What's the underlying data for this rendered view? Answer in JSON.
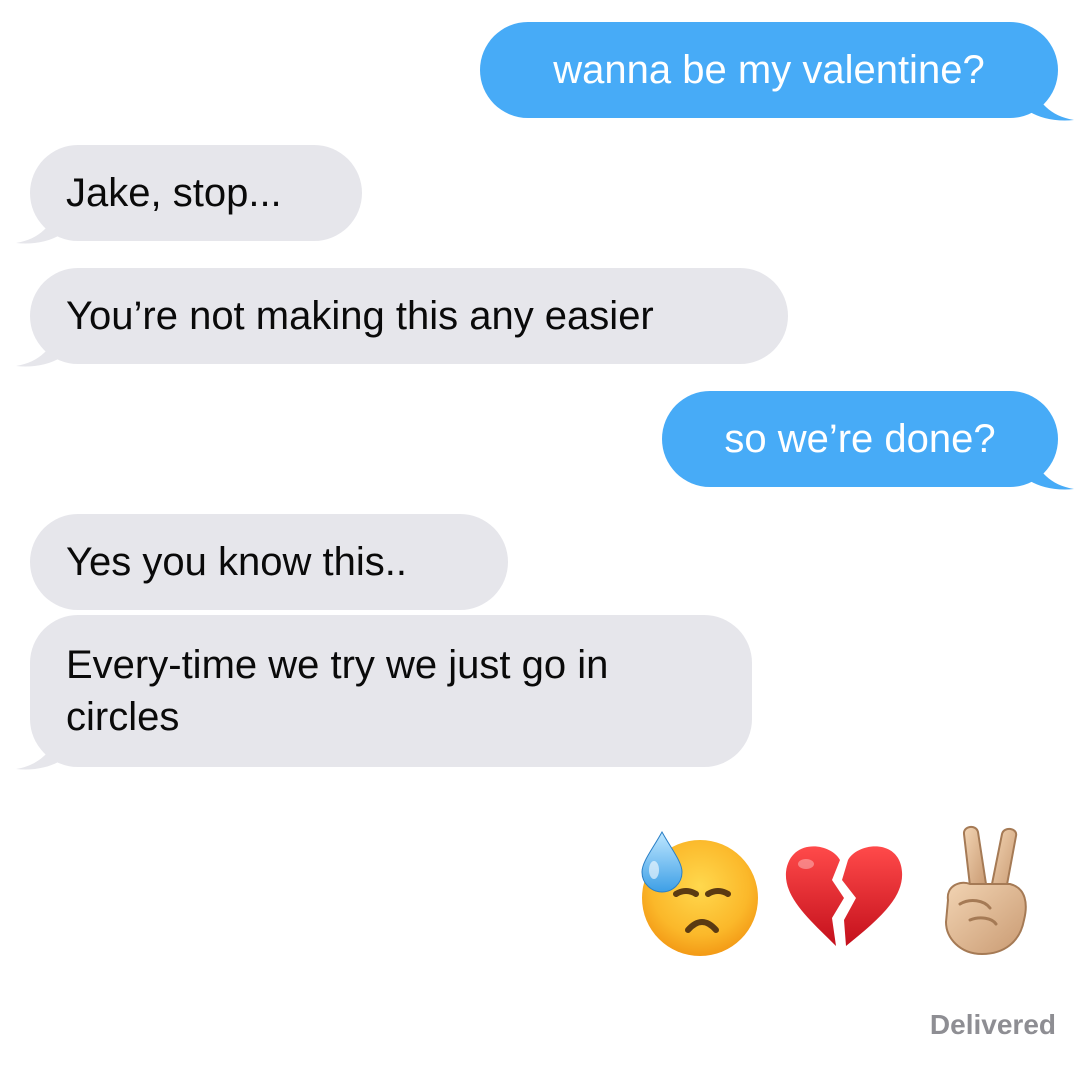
{
  "messages": [
    {
      "id": "m1",
      "direction": "sent",
      "text": "wanna be my valentine?"
    },
    {
      "id": "m2",
      "direction": "received",
      "text": "Jake, stop..."
    },
    {
      "id": "m3",
      "direction": "received",
      "text": "You’re not making this any easier"
    },
    {
      "id": "m4",
      "direction": "sent",
      "text": "so we’re done?"
    },
    {
      "id": "m5",
      "direction": "received",
      "text": "Yes you know this.."
    },
    {
      "id": "m6",
      "direction": "received",
      "text": "Every-time we try we just go in circles"
    }
  ],
  "emojis": [
    {
      "name": "downcast-face-with-sweat-icon"
    },
    {
      "name": "broken-heart-icon"
    },
    {
      "name": "victory-hand-icon"
    }
  ],
  "status": "Delivered",
  "colors": {
    "sent_bubble": "#47abf7",
    "received_bubble": "#e6e6eb",
    "sent_text": "#ffffff",
    "received_text": "#0a0a0a",
    "status_text": "#8e8e93"
  }
}
